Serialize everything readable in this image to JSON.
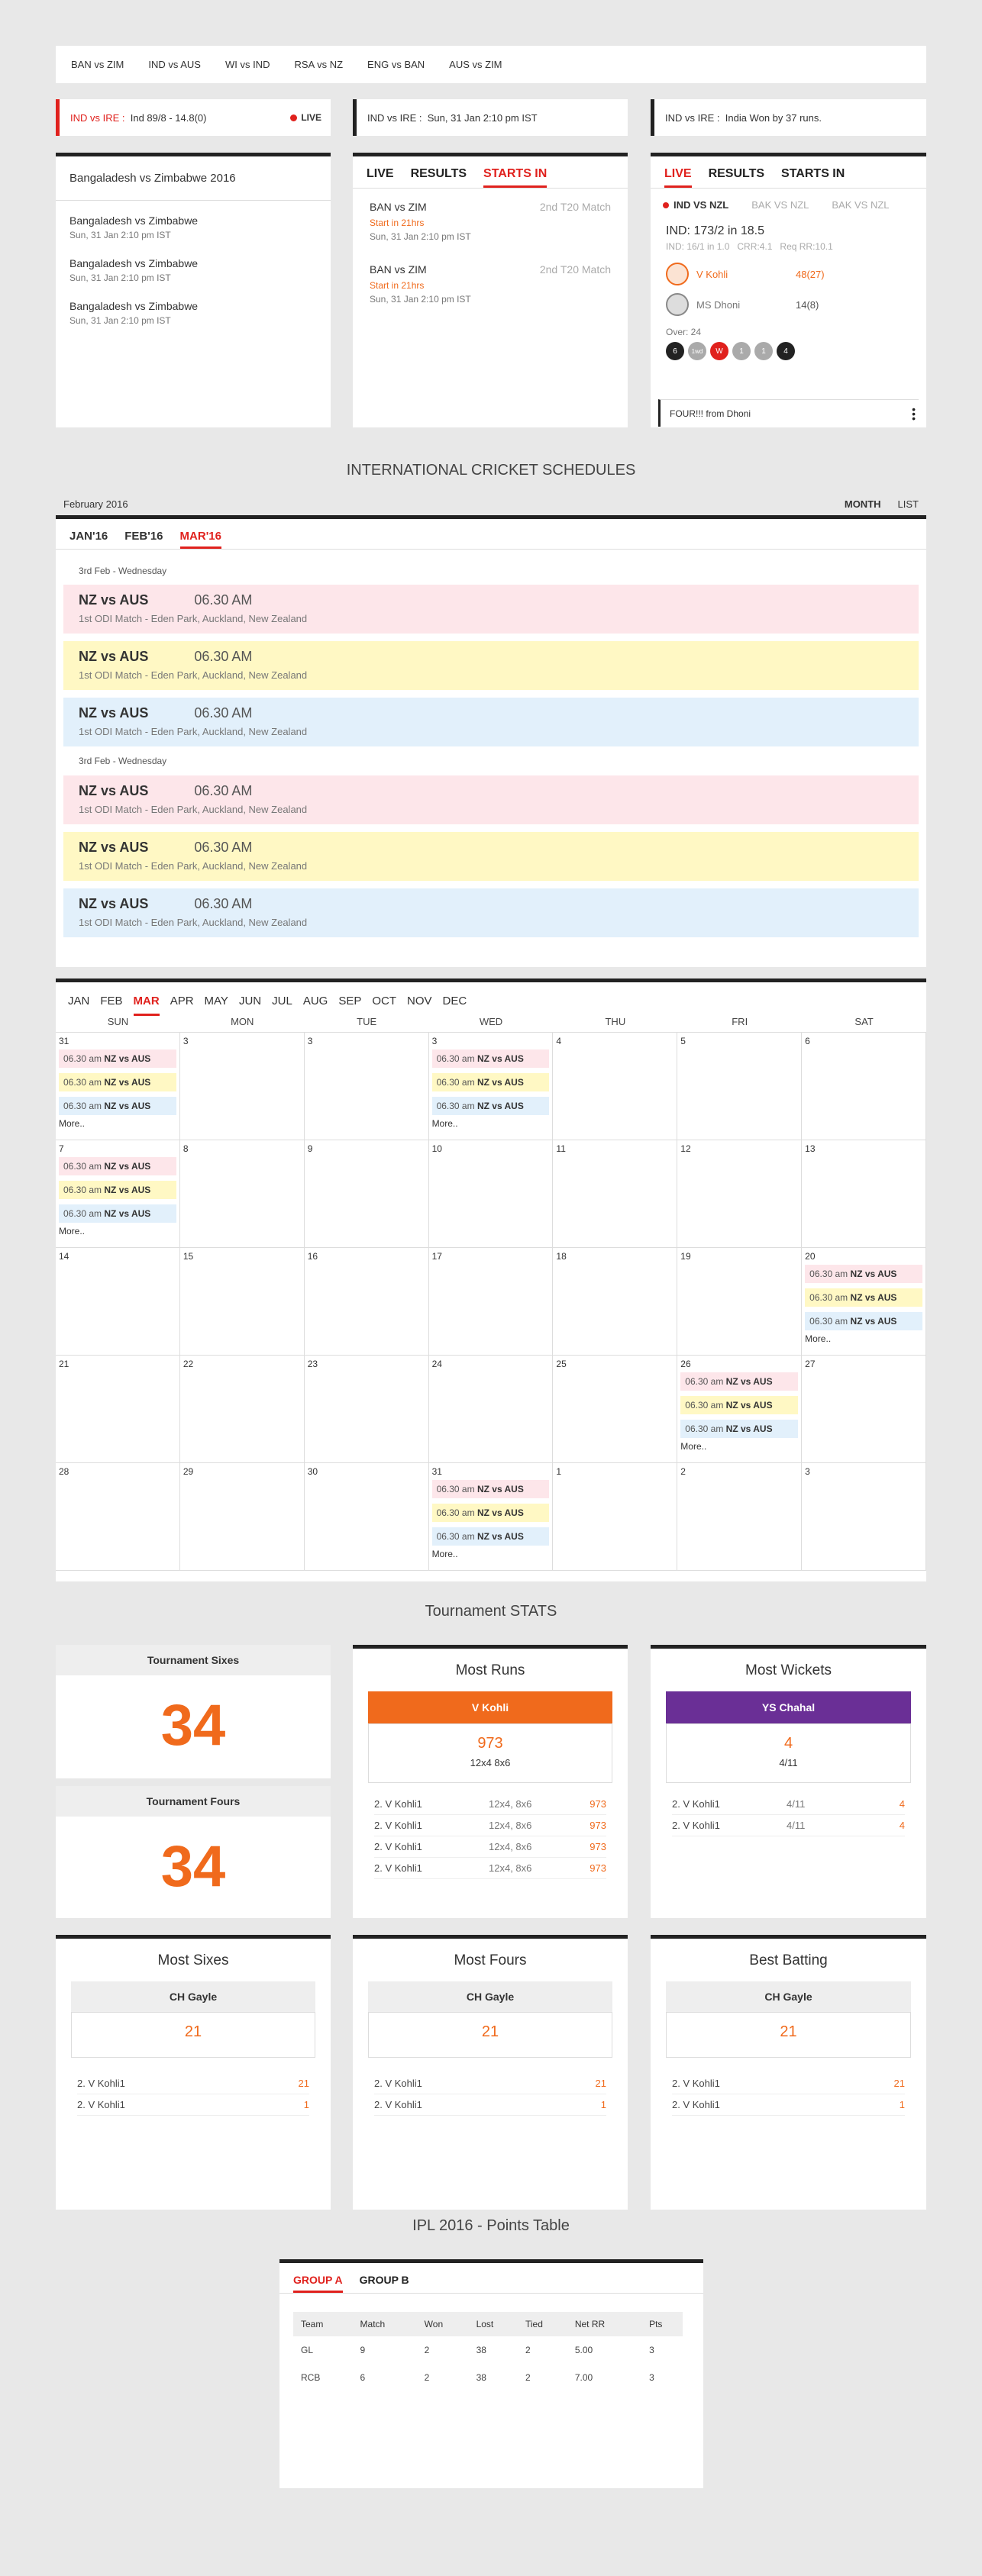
{
  "topbar": {
    "items": [
      "BAN vs ZIM",
      "IND vs AUS",
      "WI vs IND",
      "RSA vs NZ",
      "ENG vs BAN",
      "AUS vs ZIM"
    ]
  },
  "tickers": [
    {
      "tag": "IND vs IRE :",
      "text": "Ind 89/8 - 14.8(0)",
      "badge": "LIVE"
    },
    {
      "tag": "IND vs IRE :",
      "text": "Sun, 31 Jan 2:10 pm IST"
    },
    {
      "tag": "IND vs IRE :",
      "text": "India Won by 37 runs."
    }
  ],
  "box1": {
    "title": "Bangaladesh vs Zimbabwe 2016",
    "items": [
      {
        "name": "Bangaladesh vs Zimbabwe",
        "date": "Sun, 31 Jan 2:10 pm IST"
      },
      {
        "name": "Bangaladesh vs Zimbabwe",
        "date": "Sun, 31 Jan 2:10 pm IST"
      },
      {
        "name": "Bangaladesh vs Zimbabwe",
        "date": "Sun, 31 Jan 2:10 pm IST"
      }
    ]
  },
  "tabs": {
    "live": "LIVE",
    "results": "RESULTS",
    "starts": "STARTS IN"
  },
  "box2": {
    "items": [
      {
        "name": "BAN vs ZIM",
        "type": "2nd T20 Match",
        "start": "Start in 21hrs",
        "date": "Sun, 31 Jan 2:10 pm IST"
      },
      {
        "name": "BAN vs ZIM",
        "type": "2nd T20 Match",
        "start": "Start in 21hrs",
        "date": "Sun, 31 Jan 2:10 pm IST"
      }
    ]
  },
  "box3": {
    "match_tabs": [
      "IND VS NZL",
      "BAK VS NZL",
      "BAK VS NZL"
    ],
    "score": "IND: 173/2 in 18.5",
    "meta": [
      "IND: 16/1 in 1.0",
      "CRR:4.1",
      "Req RR:10.1"
    ],
    "batsmen": [
      {
        "name": "V Kohli",
        "runs": "48(27)"
      },
      {
        "name": "MS Dhoni",
        "runs": "14(8)"
      }
    ],
    "over_label": "Over: 24",
    "balls": [
      "6",
      "1wd",
      "W",
      "1",
      "1",
      "4"
    ],
    "commentary": "FOUR!!! from Dhoni"
  },
  "schedules": {
    "heading": "INTERNATIONAL CRICKET SCHEDULES",
    "month": "February 2016",
    "views": [
      "MONTH",
      "LIST"
    ],
    "month_tabs": [
      "JAN'16",
      "FEB'16",
      "MAR'16"
    ],
    "groups": [
      {
        "day": "3rd Feb - Wednesday",
        "matches": [
          {
            "teams": "NZ vs AUS",
            "time": "06.30 AM",
            "venue": "1st ODI Match - Eden Park, Auckland, New Zealand"
          },
          {
            "teams": "NZ vs AUS",
            "time": "06.30 AM",
            "venue": "1st ODI Match - Eden Park, Auckland, New Zealand"
          },
          {
            "teams": "NZ vs AUS",
            "time": "06.30 AM",
            "venue": "1st ODI Match - Eden Park, Auckland, New Zealand"
          }
        ]
      },
      {
        "day": "3rd Feb - Wednesday",
        "matches": [
          {
            "teams": "NZ vs AUS",
            "time": "06.30 AM",
            "venue": "1st ODI Match - Eden Park, Auckland, New Zealand"
          },
          {
            "teams": "NZ vs AUS",
            "time": "06.30 AM",
            "venue": "1st ODI Match - Eden Park, Auckland, New Zealand"
          },
          {
            "teams": "NZ vs AUS",
            "time": "06.30 AM",
            "venue": "1st ODI Match - Eden Park, Auckland, New Zealand"
          }
        ]
      }
    ]
  },
  "calendar": {
    "months": [
      "JAN",
      "FEB",
      "MAR",
      "APR",
      "MAY",
      "JUN",
      "JUL",
      "AUG",
      "SEP",
      "OCT",
      "NOV",
      "DEC"
    ],
    "dows": [
      "SUN",
      "MON",
      "TUE",
      "WED",
      "THU",
      "FRI",
      "SAT"
    ],
    "event_time": "06.30 am",
    "event_name": "NZ vs AUS",
    "more": "More..",
    "days": [
      "31",
      "3",
      "3",
      "3",
      "4",
      "5",
      "6",
      "7",
      "8",
      "9",
      "10",
      "11",
      "12",
      "13",
      "14",
      "15",
      "16",
      "17",
      "18",
      "19",
      "20",
      "21",
      "22",
      "23",
      "24",
      "25",
      "26",
      "27",
      "28",
      "29",
      "30",
      "31",
      "1",
      "2",
      "3"
    ],
    "event_days": [
      0,
      3,
      7,
      20,
      26,
      31
    ]
  },
  "stats": {
    "heading": "Tournament STATS",
    "sixes_label": "Tournament Sixes",
    "sixes": "34",
    "fours_label": "Tournament Fours",
    "fours": "34",
    "most_runs": {
      "title": "Most Runs",
      "name": "V Kohli",
      "value": "973",
      "sub": "12x4 8x6",
      "color": "#f06a1c",
      "rows": [
        [
          "2. V Kohli1",
          "12x4, 8x6",
          "973"
        ],
        [
          "2. V Kohli1",
          "12x4, 8x6",
          "973"
        ],
        [
          "2. V Kohli1",
          "12x4, 8x6",
          "973"
        ],
        [
          "2. V Kohli1",
          "12x4, 8x6",
          "973"
        ]
      ]
    },
    "most_wickets": {
      "title": "Most Wickets",
      "name": "YS Chahal",
      "value": "4",
      "sub": "4/11",
      "color": "#6a2f96",
      "rows": [
        [
          "2. V Kohli1",
          "4/11",
          "4"
        ],
        [
          "2. V Kohli1",
          "4/11",
          "4"
        ]
      ]
    },
    "most_sixes": {
      "title": "Most Sixes",
      "name": "CH Gayle",
      "value": "21",
      "rows": [
        [
          "2. V Kohli1",
          "",
          "21"
        ],
        [
          "2. V Kohli1",
          "",
          "1"
        ]
      ]
    },
    "most_fours": {
      "title": "Most Fours",
      "name": "CH Gayle",
      "value": "21",
      "rows": [
        [
          "2. V Kohli1",
          "",
          "21"
        ],
        [
          "2. V Kohli1",
          "",
          "1"
        ]
      ]
    },
    "best_batting": {
      "title": "Best Batting",
      "name": "CH Gayle",
      "value": "21",
      "rows": [
        [
          "2. V Kohli1",
          "",
          "21"
        ],
        [
          "2. V Kohli1",
          "",
          "1"
        ]
      ]
    }
  },
  "points": {
    "heading": "IPL 2016 - Points Table",
    "groups": [
      "GROUP A",
      "GROUP B"
    ],
    "cols": [
      "Team",
      "Match",
      "Won",
      "Lost",
      "Tied",
      "Net RR",
      "Pts"
    ],
    "rows": [
      [
        "GL",
        "9",
        "2",
        "38",
        "2",
        "5.00",
        "3"
      ],
      [
        "RCB",
        "6",
        "2",
        "38",
        "2",
        "7.00",
        "3"
      ]
    ]
  }
}
